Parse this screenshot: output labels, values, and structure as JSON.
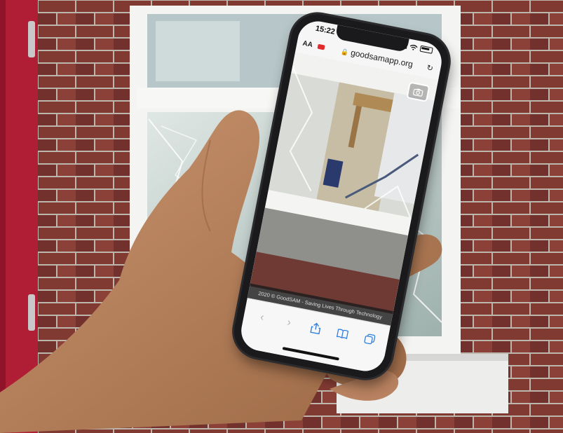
{
  "phone": {
    "status": {
      "time": "15:22"
    },
    "address_bar": {
      "text_size_label": "AA",
      "url": "goodsamapp.org"
    },
    "footer_text": "2020 © GoodSAM - Saving Lives Through Technology",
    "icons": {
      "record": "recording-icon",
      "lock": "lock-icon",
      "reload": "reload-icon",
      "camera": "camera-switch-icon",
      "back": "back-icon",
      "forward": "forward-icon",
      "share": "share-icon",
      "bookmarks": "bookmarks-icon",
      "tabs": "tabs-icon"
    }
  },
  "colors": {
    "record_red": "#e02b2b",
    "toolbar_active": "#2f7fe0",
    "door_red": "#b01e35",
    "brick": "#8a3e36"
  }
}
